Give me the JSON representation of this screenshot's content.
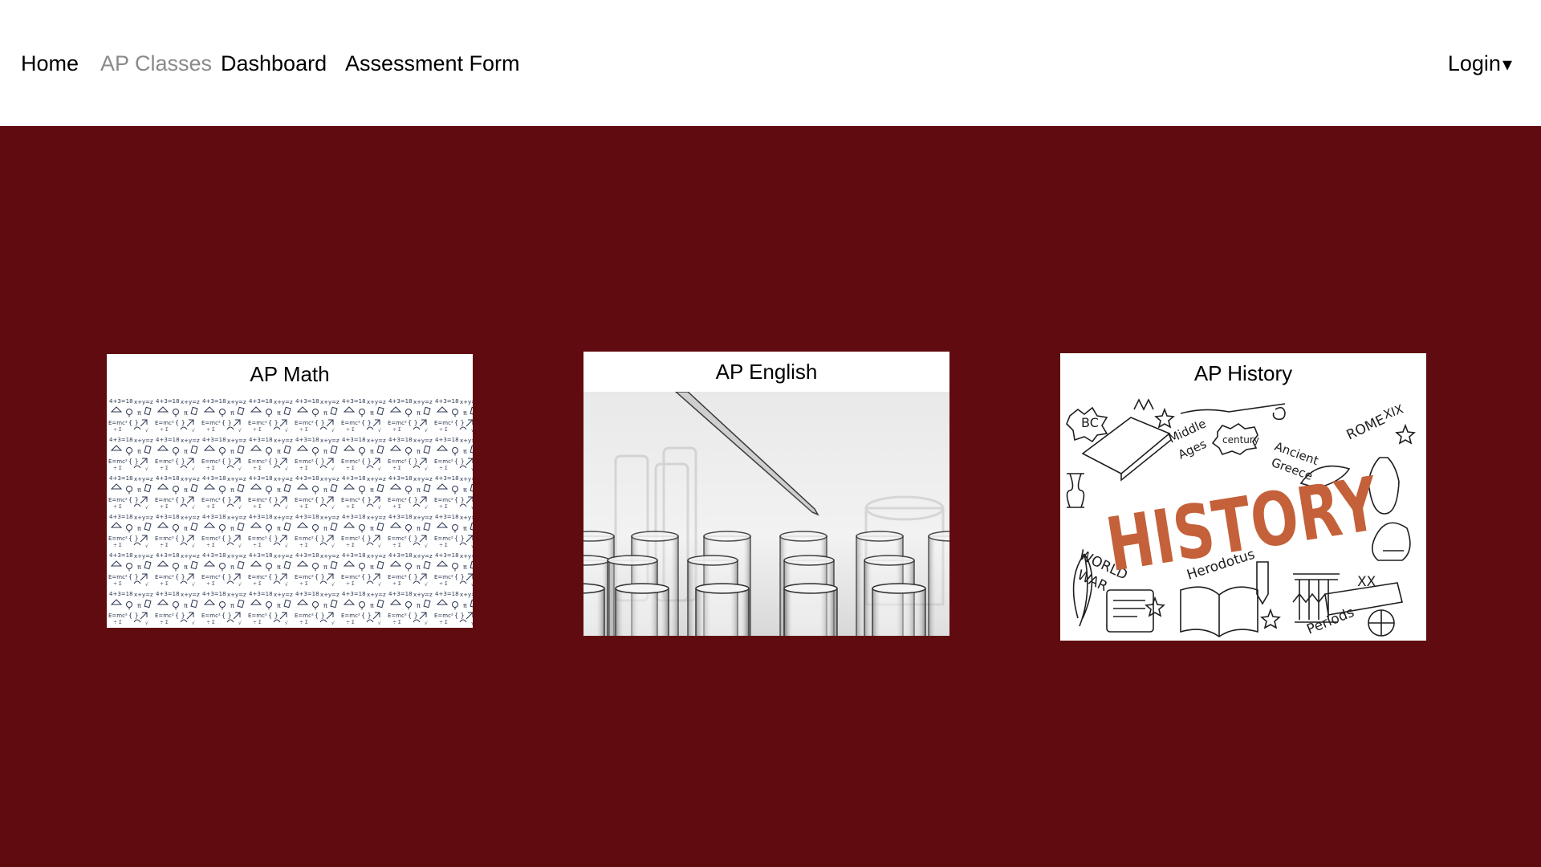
{
  "nav": {
    "items": [
      {
        "label": "Home",
        "active": false
      },
      {
        "label": "AP Classes",
        "active": true
      },
      {
        "label": "Dashboard",
        "active": false
      },
      {
        "label": "Assessment Form",
        "active": false
      }
    ],
    "login_label": "Login",
    "login_caret": "▾"
  },
  "page": {
    "background_color": "#600b10",
    "nav_background": "#ffffff",
    "active_link_color": "#8a8a8a"
  },
  "cards": [
    {
      "title": "AP Math",
      "image": "math-doodle-pattern"
    },
    {
      "title": "AP English",
      "image": "test-tubes-photo"
    },
    {
      "title": "AP History",
      "image": "history-doodle",
      "image_text": {
        "headline": "HISTORY",
        "bc": "BC",
        "middle": "Middle",
        "ages": "Ages",
        "century": "century",
        "ancient": "Ancient",
        "greece": "Greece",
        "rome": "ROME",
        "xix": "XIX",
        "world": "WORLD",
        "war": "WAR",
        "herodotus": "Herodotus",
        "xx": "XX",
        "periods": "Periods"
      }
    }
  ]
}
